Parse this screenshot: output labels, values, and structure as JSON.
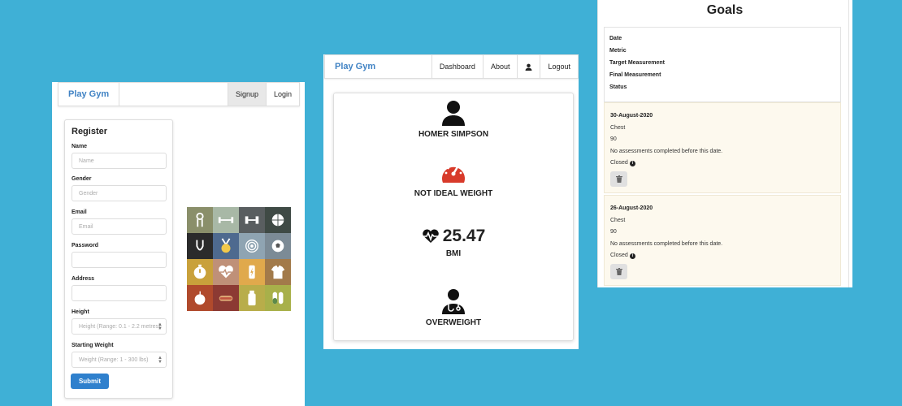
{
  "register_screen": {
    "nav": {
      "brand": "Play Gym",
      "signup": "Signup",
      "login": "Login"
    },
    "title": "Register",
    "fields": [
      {
        "label": "Name",
        "placeholder": "Name"
      },
      {
        "label": "Gender",
        "placeholder": "Gender"
      },
      {
        "label": "Email",
        "placeholder": "Email"
      },
      {
        "label": "Password",
        "placeholder": ""
      },
      {
        "label": "Address",
        "placeholder": ""
      },
      {
        "label": "Height",
        "placeholder": "Height (Range: 0.1 - 2.2 metres)"
      },
      {
        "label": "Starting Weight",
        "placeholder": "Weight (Range: 1 - 300 lbs)"
      }
    ],
    "submit": "Submit",
    "icon_tiles": [
      {
        "icon": "hand-grip-icon",
        "color": "#8a8f6a"
      },
      {
        "icon": "barbell-icon",
        "color": "#a8b8a6"
      },
      {
        "icon": "dumbbell-icon",
        "color": "#595e60"
      },
      {
        "icon": "basketball-icon",
        "color": "#3f4a45"
      },
      {
        "icon": "jump-rope-icon",
        "color": "#2b2b2b"
      },
      {
        "icon": "medal-icon",
        "color": "#4e6a8f"
      },
      {
        "icon": "target-icon",
        "color": "#8fa4b2"
      },
      {
        "icon": "soccer-ball-icon",
        "color": "#7c8b96"
      },
      {
        "icon": "stopwatch-icon",
        "color": "#c9a13b"
      },
      {
        "icon": "heart-rate-icon",
        "color": "#bf9078"
      },
      {
        "icon": "energy-drink-icon",
        "color": "#e0a94c"
      },
      {
        "icon": "shirt-icon",
        "color": "#a27a4a"
      },
      {
        "icon": "apple-icon",
        "color": "#b04a2c"
      },
      {
        "icon": "hotdog-icon",
        "color": "#8c3a33"
      },
      {
        "icon": "bottle-icon",
        "color": "#b8ad4a"
      },
      {
        "icon": "pills-icon",
        "color": "#a8b04a"
      }
    ]
  },
  "dashboard_screen": {
    "nav": {
      "brand": "Play Gym",
      "dashboard": "Dashboard",
      "about": "About",
      "logout": "Logout"
    },
    "member_name": "HOMER SIMPSON",
    "weight_indicator": "NOT IDEAL WEIGHT",
    "bmi_value": "25.47",
    "bmi_label": "BMI",
    "bmi_category": "OVERWEIGHT",
    "colors": {
      "gauge": "#d83a2a"
    }
  },
  "goals_screen": {
    "title": "Goals",
    "headers": [
      "Date",
      "Metric",
      "Target Measurement",
      "Final Measurement",
      "Status"
    ],
    "goals": [
      {
        "date": "30-August-2020",
        "metric": "Chest",
        "target": "90",
        "final": "No assessments completed before this date.",
        "status": "Closed"
      },
      {
        "date": "26-August-2020",
        "metric": "Chest",
        "target": "90",
        "final": "No assessments completed before this date.",
        "status": "Closed"
      }
    ]
  }
}
